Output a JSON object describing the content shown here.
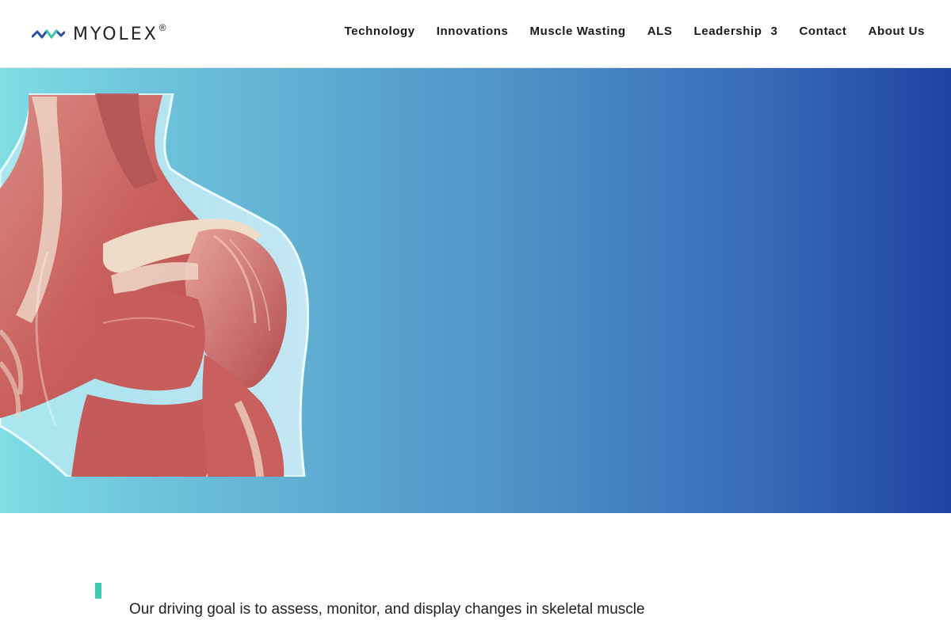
{
  "header": {
    "logo": {
      "text": "MYOLEX",
      "registered": "®",
      "icon": "zigzag-wave-icon",
      "colors": {
        "wave_dark": "#2c4f9e",
        "wave_light": "#3ec9b1"
      }
    },
    "nav": {
      "items": [
        {
          "label": "Technology"
        },
        {
          "label": "Innovations"
        },
        {
          "label": "Muscle Wasting"
        },
        {
          "label": "ALS"
        },
        {
          "label": "Leadership",
          "dropdown_icon": "3"
        },
        {
          "label": "Contact"
        },
        {
          "label": "About Us"
        }
      ]
    }
  },
  "hero": {
    "image": "shoulder-muscle-anatomy-illustration",
    "colors": {
      "gradient_start": "#7fdde3",
      "gradient_end": "#1f43a0"
    }
  },
  "intro": {
    "text": "Our driving goal is to assess, monitor, and display changes in skeletal muscle",
    "accent_color": "#3ec9b1"
  }
}
